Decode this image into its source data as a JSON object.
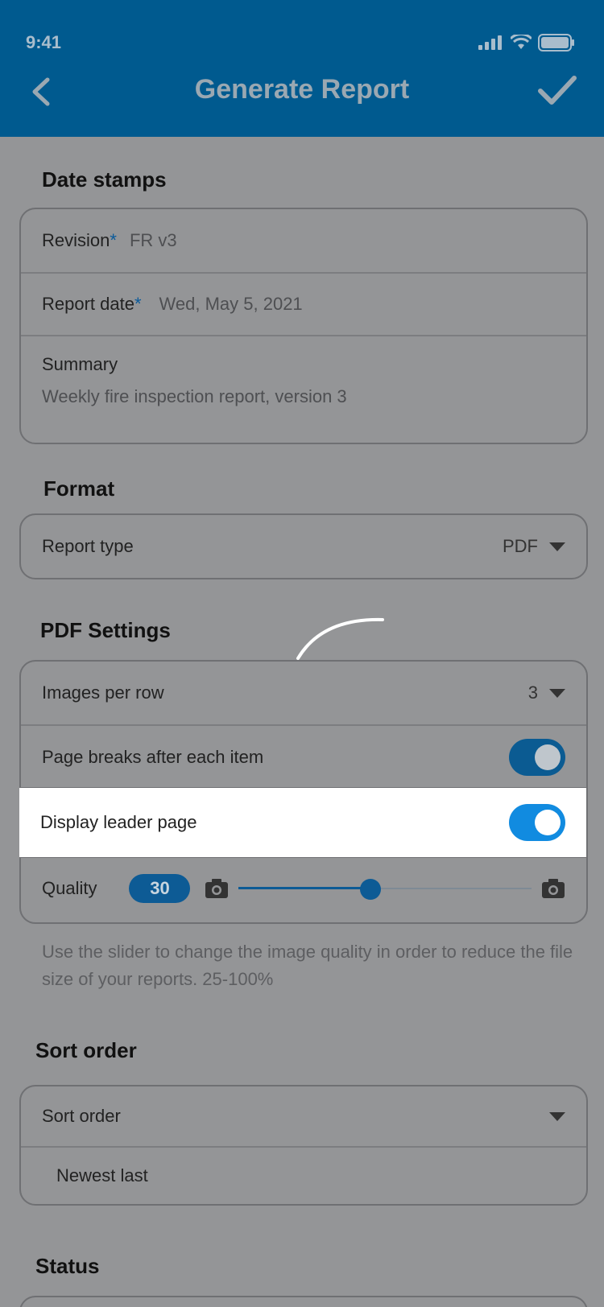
{
  "status_bar": {
    "time": "9:41",
    "icons": [
      "signal-icon",
      "wifi-icon",
      "battery-icon"
    ]
  },
  "header": {
    "title": "Generate Report",
    "back_icon": "chevron-left-icon",
    "confirm_icon": "checkmark-icon"
  },
  "date_stamps": {
    "title": "Date stamps",
    "revision_label": "Revision",
    "revision_value": "FR v3",
    "report_date_label": "Report date",
    "report_date_value": "Wed, May 5, 2021",
    "required_mark": "*",
    "summary_label": "Summary",
    "summary_value": "Weekly fire inspection report, version 3"
  },
  "format": {
    "title": "Format",
    "report_type_label": "Report type",
    "report_type_value": "PDF"
  },
  "pdf_settings": {
    "title": "PDF Settings",
    "images_per_row_label": "Images per row",
    "images_per_row_value": "3",
    "page_breaks_label": "Page breaks after each item",
    "page_breaks_on": true,
    "leader_page_label": "Display leader page",
    "leader_page_on": true,
    "quality_label": "Quality",
    "quality_value": "30",
    "quality_slider_fraction": 0.45,
    "help_text": "Use the slider to change the image quality in order to reduce the file size of your reports. 25-100%"
  },
  "sort_order": {
    "title": "Sort order",
    "label": "Sort order",
    "value": "Newest last"
  },
  "status": {
    "title": "Status"
  },
  "colors": {
    "header": "#005a8f",
    "accent": "#118be0",
    "overlay_bg": "#949597"
  }
}
